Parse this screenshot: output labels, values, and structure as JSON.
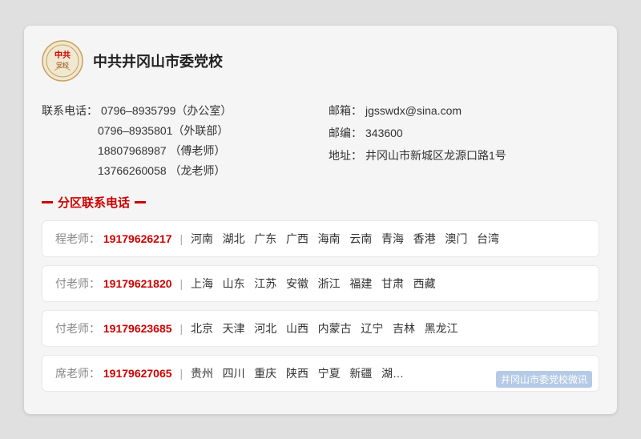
{
  "header": {
    "org_name": "中共井冈山市委党校"
  },
  "contact": {
    "phone_label": "联系电话：",
    "phone1": "0796–8935799",
    "phone1_note": "（办公室）",
    "phone2": "0796–8935801",
    "phone2_note": "（外联部）",
    "phone3": "18807968987",
    "phone3_note": "（傅老师）",
    "phone4": "13766260058",
    "phone4_note": "（龙老师）",
    "email_label": "邮箱：",
    "email": "jgsswdx@sina.com",
    "postcode_label": "邮编：",
    "postcode": "343600",
    "address_label": "地址：",
    "address": "井冈山市新城区龙源口路1号"
  },
  "section_title": "分区联系电话",
  "regions": [
    {
      "teacher_name": "程老师：",
      "teacher_phone": "19179626217",
      "areas": "河南  湖北  广东  广西  海南  云南  青海  香港  澳门  台湾"
    },
    {
      "teacher_name": "付老师：",
      "teacher_phone": "19179621820",
      "areas": "上海  山东  江苏  安徽  浙江  福建  甘肃  西藏"
    },
    {
      "teacher_name": "付老师：",
      "teacher_phone": "19179623685",
      "areas": "北京  天津  河北  山西  内蒙古  辽宁  吉林  黑龙江"
    },
    {
      "teacher_name": "席老师：",
      "teacher_phone": "19179627065",
      "areas": "贵州  四川  重庆  陕西  宁夏  新疆  湖…"
    }
  ],
  "watermark_text": "井冈山市委党校微讯"
}
